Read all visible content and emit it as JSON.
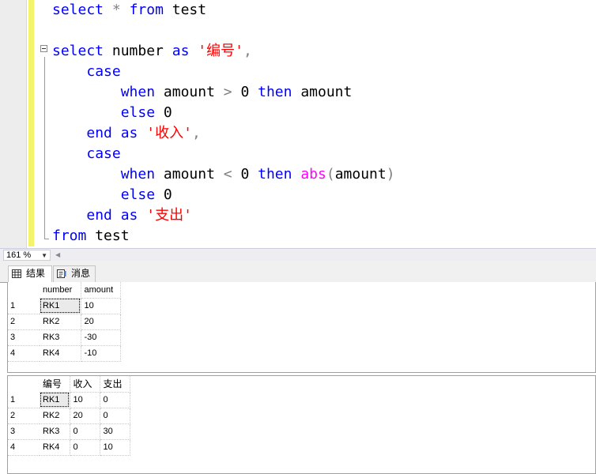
{
  "editor": {
    "lines": [
      [
        {
          "t": "select",
          "c": "kw"
        },
        {
          "t": " ",
          "c": ""
        },
        {
          "t": "*",
          "c": "op"
        },
        {
          "t": " ",
          "c": ""
        },
        {
          "t": "from",
          "c": "kw"
        },
        {
          "t": " test",
          "c": ""
        }
      ],
      [],
      [
        {
          "t": "select",
          "c": "kw"
        },
        {
          "t": " number ",
          "c": ""
        },
        {
          "t": "as",
          "c": "kw"
        },
        {
          "t": " ",
          "c": ""
        },
        {
          "t": "'编号'",
          "c": "str"
        },
        {
          "t": ",",
          "c": "op"
        }
      ],
      [
        {
          "t": "    ",
          "c": ""
        },
        {
          "t": "case",
          "c": "kw"
        }
      ],
      [
        {
          "t": "        ",
          "c": ""
        },
        {
          "t": "when",
          "c": "kw"
        },
        {
          "t": " amount ",
          "c": ""
        },
        {
          "t": ">",
          "c": "op"
        },
        {
          "t": " 0 ",
          "c": ""
        },
        {
          "t": "then",
          "c": "kw"
        },
        {
          "t": " amount",
          "c": ""
        }
      ],
      [
        {
          "t": "        ",
          "c": ""
        },
        {
          "t": "else",
          "c": "kw"
        },
        {
          "t": " 0",
          "c": ""
        }
      ],
      [
        {
          "t": "    ",
          "c": ""
        },
        {
          "t": "end",
          "c": "kw"
        },
        {
          "t": " ",
          "c": ""
        },
        {
          "t": "as",
          "c": "kw"
        },
        {
          "t": " ",
          "c": ""
        },
        {
          "t": "'收入'",
          "c": "str"
        },
        {
          "t": ",",
          "c": "op"
        }
      ],
      [
        {
          "t": "    ",
          "c": ""
        },
        {
          "t": "case",
          "c": "kw"
        }
      ],
      [
        {
          "t": "        ",
          "c": ""
        },
        {
          "t": "when",
          "c": "kw"
        },
        {
          "t": " amount ",
          "c": ""
        },
        {
          "t": "<",
          "c": "op"
        },
        {
          "t": " 0 ",
          "c": ""
        },
        {
          "t": "then",
          "c": "kw"
        },
        {
          "t": " ",
          "c": ""
        },
        {
          "t": "abs",
          "c": "fn"
        },
        {
          "t": "(",
          "c": "op"
        },
        {
          "t": "amount",
          "c": ""
        },
        {
          "t": ")",
          "c": "op"
        }
      ],
      [
        {
          "t": "        ",
          "c": ""
        },
        {
          "t": "else",
          "c": "kw"
        },
        {
          "t": " 0",
          "c": ""
        }
      ],
      [
        {
          "t": "    ",
          "c": ""
        },
        {
          "t": "end",
          "c": "kw"
        },
        {
          "t": " ",
          "c": ""
        },
        {
          "t": "as",
          "c": "kw"
        },
        {
          "t": " ",
          "c": ""
        },
        {
          "t": "'支出'",
          "c": "str"
        }
      ],
      [
        {
          "t": "from",
          "c": "kw"
        },
        {
          "t": " test",
          "c": ""
        }
      ]
    ]
  },
  "zoom": {
    "value": "161 %"
  },
  "tabs": {
    "results_label": "结果",
    "messages_label": "消息"
  },
  "grid1": {
    "columns": [
      "number",
      "amount"
    ],
    "rows": [
      {
        "n": "1",
        "cells": [
          "RK1",
          "10"
        ]
      },
      {
        "n": "2",
        "cells": [
          "RK2",
          "20"
        ]
      },
      {
        "n": "3",
        "cells": [
          "RK3",
          "-30"
        ]
      },
      {
        "n": "4",
        "cells": [
          "RK4",
          "-10"
        ]
      }
    ]
  },
  "grid2": {
    "columns": [
      "编号",
      "收入",
      "支出"
    ],
    "rows": [
      {
        "n": "1",
        "cells": [
          "RK1",
          "10",
          "0"
        ]
      },
      {
        "n": "2",
        "cells": [
          "RK2",
          "20",
          "0"
        ]
      },
      {
        "n": "3",
        "cells": [
          "RK3",
          "0",
          "30"
        ]
      },
      {
        "n": "4",
        "cells": [
          "RK4",
          "0",
          "10"
        ]
      }
    ]
  },
  "colors": {
    "keyword": "#0000ff",
    "string": "#ff0000",
    "function": "#ff00ff",
    "operator": "#808080",
    "change_bar": "#f4f46a"
  },
  "icons": {
    "results_tab": "grid-icon",
    "messages_tab": "message-icon",
    "outline": "collapse-icon"
  }
}
